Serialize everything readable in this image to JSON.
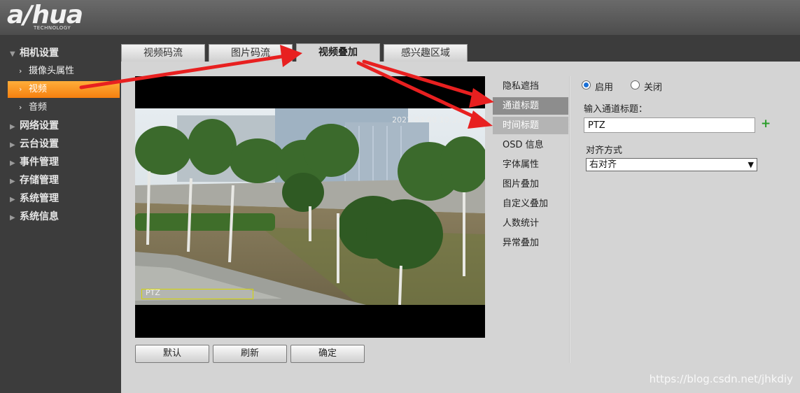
{
  "brand": {
    "logo": "a/hua",
    "logo_sub": "TECHNOLOGY"
  },
  "sidebar": {
    "groups": [
      {
        "label": "相机设置",
        "expanded": true
      },
      {
        "label": "网络设置"
      },
      {
        "label": "云台设置"
      },
      {
        "label": "事件管理"
      },
      {
        "label": "存储管理"
      },
      {
        "label": "系统管理"
      },
      {
        "label": "系统信息"
      }
    ],
    "sub_items": [
      {
        "label": "摄像头属性"
      },
      {
        "label": "视频",
        "active": true
      },
      {
        "label": "音频"
      }
    ]
  },
  "tabs": [
    {
      "label": "视频码流"
    },
    {
      "label": "图片码流"
    },
    {
      "label": "视频叠加",
      "active": true
    },
    {
      "label": "感兴趣区域"
    }
  ],
  "video": {
    "osd_time": "2021-03-08 10:39:05",
    "osd_title": "PTZ"
  },
  "buttons": {
    "default": "默认",
    "refresh": "刷新",
    "confirm": "确定"
  },
  "submenu": [
    {
      "label": "隐私遮挡"
    },
    {
      "label": "通道标题",
      "selected": true
    },
    {
      "label": "时间标题",
      "hover": true
    },
    {
      "label": "OSD 信息"
    },
    {
      "label": "字体属性"
    },
    {
      "label": "图片叠加"
    },
    {
      "label": "自定义叠加"
    },
    {
      "label": "人数统计"
    },
    {
      "label": "异常叠加"
    }
  ],
  "panel": {
    "enable_label": "启用",
    "disable_label": "关闭",
    "enabled": true,
    "title_label": "输入通道标题：",
    "title_value": "PTZ",
    "align_label": "对齐方式",
    "align_value": "右对齐"
  },
  "watermark": "https://blog.csdn.net/jhkdiy",
  "colors": {
    "accent": "#f57f0f",
    "arrow": "#e82020",
    "radio": "#1a6fd6",
    "add": "#2a9d2a"
  }
}
